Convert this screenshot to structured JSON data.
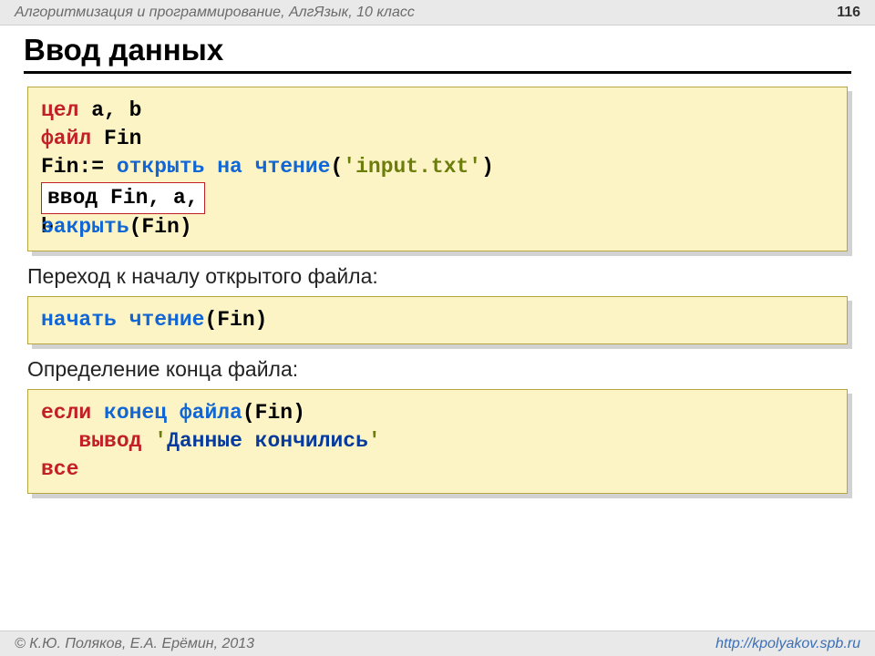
{
  "header": {
    "left": "Алгоритмизация и программирование, АлгЯзык, 10 класс",
    "pagenum": "116"
  },
  "title": "Ввод данных",
  "code1": {
    "line1_kw": "цел",
    "line1_rest": " a, b",
    "line2_kw": "файл",
    "line2_rest": " Fin",
    "line3_pre": "Fin:= ",
    "line3_fn": "открыть на чтение",
    "line3_paren_open": "(",
    "line3_lit": "'input.txt'",
    "line3_paren_close": ")",
    "line4_box_a": " ввод Fin, a, ",
    "line4_box_b": "b",
    "line5_fn": "закрыть",
    "line5_rest": "(Fin)"
  },
  "sub1": "Переход к началу открытого файла:",
  "code2": {
    "fn": "начать чтение",
    "rest": "(Fin)"
  },
  "sub2": "Определение конца файла:",
  "code3": {
    "l1_kw": "если",
    "l1_fn": " конец файла",
    "l1_rest": "(Fin)",
    "l2_indent": "   ",
    "l2_kw": "вывод ",
    "l2_lit1": "'",
    "l2_text": "Данные кончились",
    "l2_lit2": "'",
    "l3_kw": "все"
  },
  "footer": {
    "left": "© К.Ю. Поляков, Е.А. Ерёмин, 2013",
    "right": "http://kpolyakov.spb.ru"
  }
}
